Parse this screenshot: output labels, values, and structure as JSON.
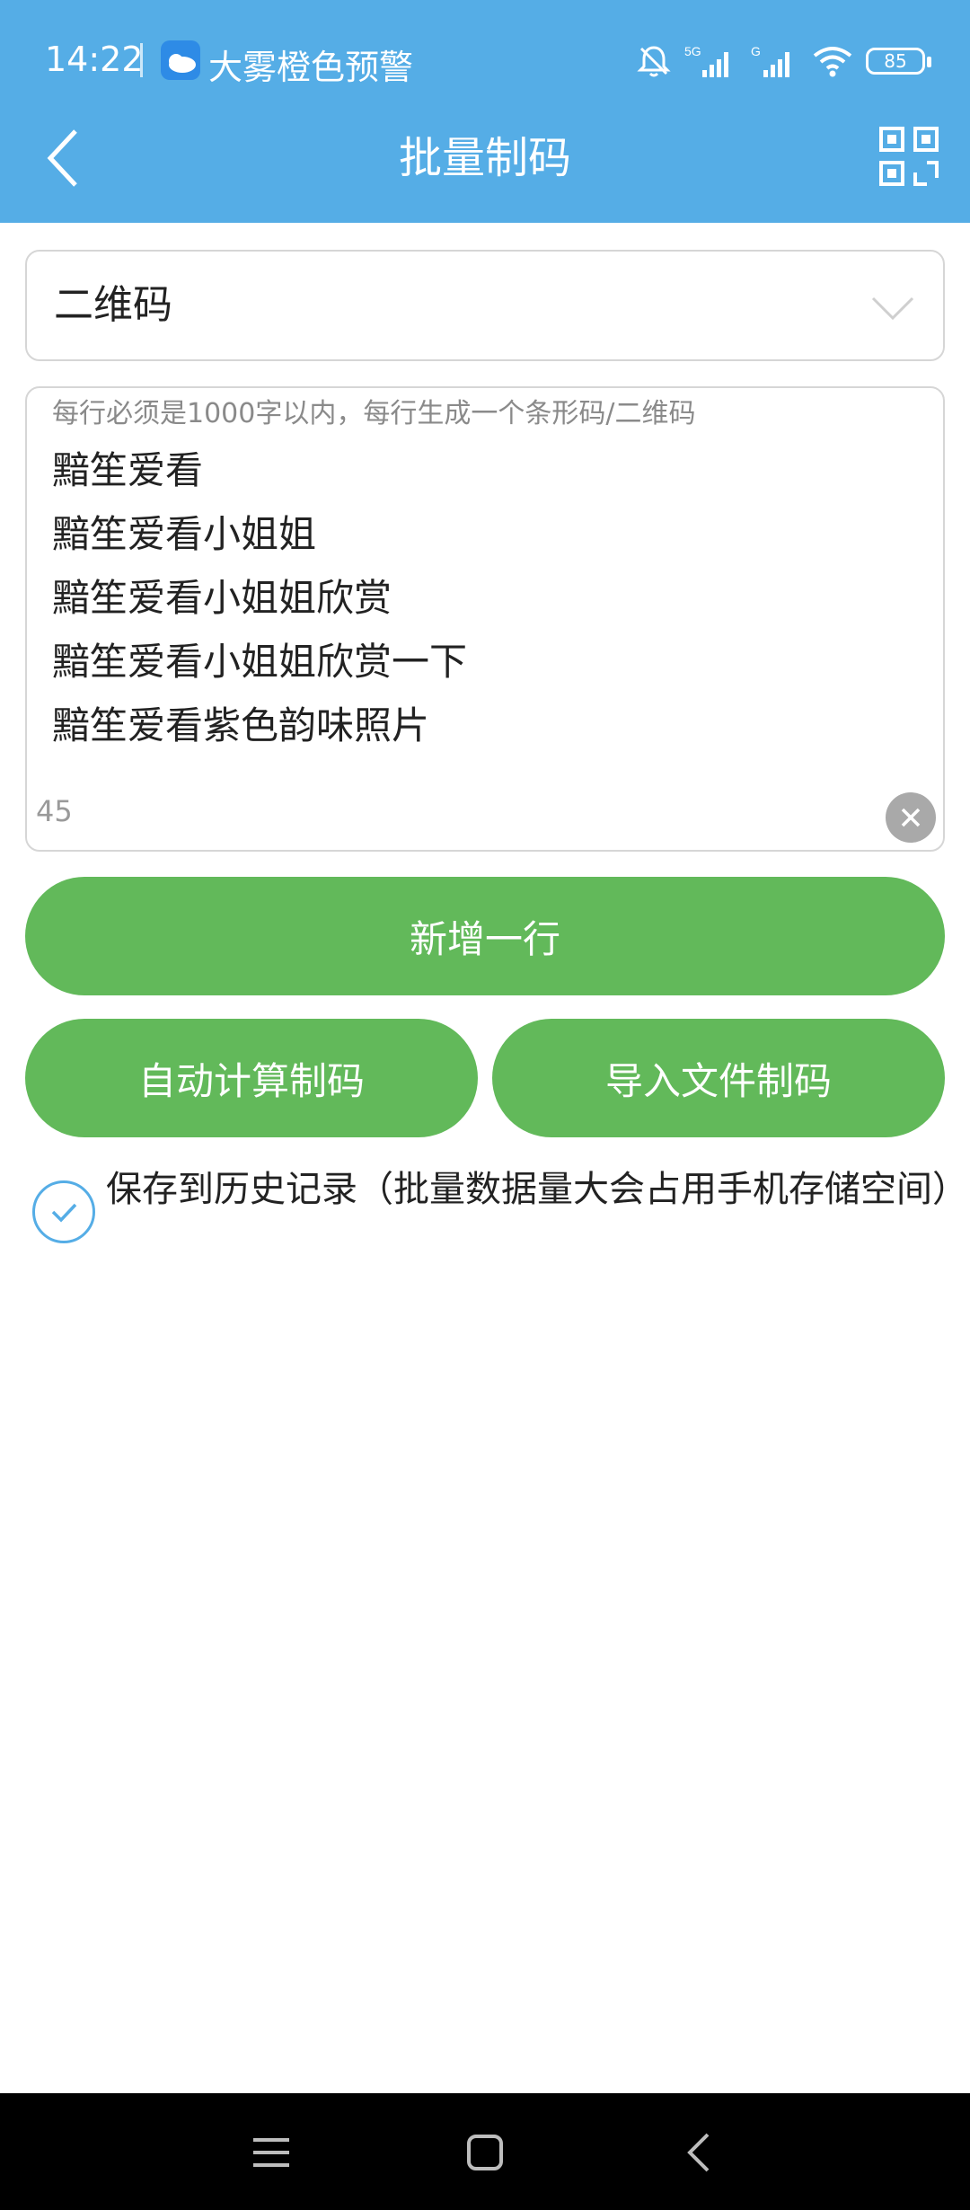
{
  "status_bar": {
    "time": "14:22",
    "weather_alert": "大雾橙色预警",
    "battery": "85",
    "network_5g": "5G",
    "network_g": "G"
  },
  "nav": {
    "title": "批量制码",
    "back_icon": "chevron-left-icon",
    "scan_icon": "qr-scan-icon"
  },
  "code_type": {
    "selected": "二维码"
  },
  "input": {
    "hint": "每行必须是1000字以内，每行生成一个条形码/二维码",
    "lines": [
      "黯笙爱看",
      "黯笙爱看小姐姐",
      "黯笙爱看小姐姐欣赏",
      "黯笙爱看小姐姐欣赏一下",
      "黯笙爱看紫色韵味照片"
    ],
    "char_count": "45"
  },
  "buttons": {
    "add_line": "新增一行",
    "auto_calc": "自动计算制码",
    "import_file": "导入文件制码"
  },
  "save_history": {
    "checked": true,
    "label": "保存到历史记录（批量数据量大会占用手机存储空间）"
  },
  "colors": {
    "header": "#55ade6",
    "button_green": "#62b95a",
    "check_blue": "#55ade6"
  }
}
